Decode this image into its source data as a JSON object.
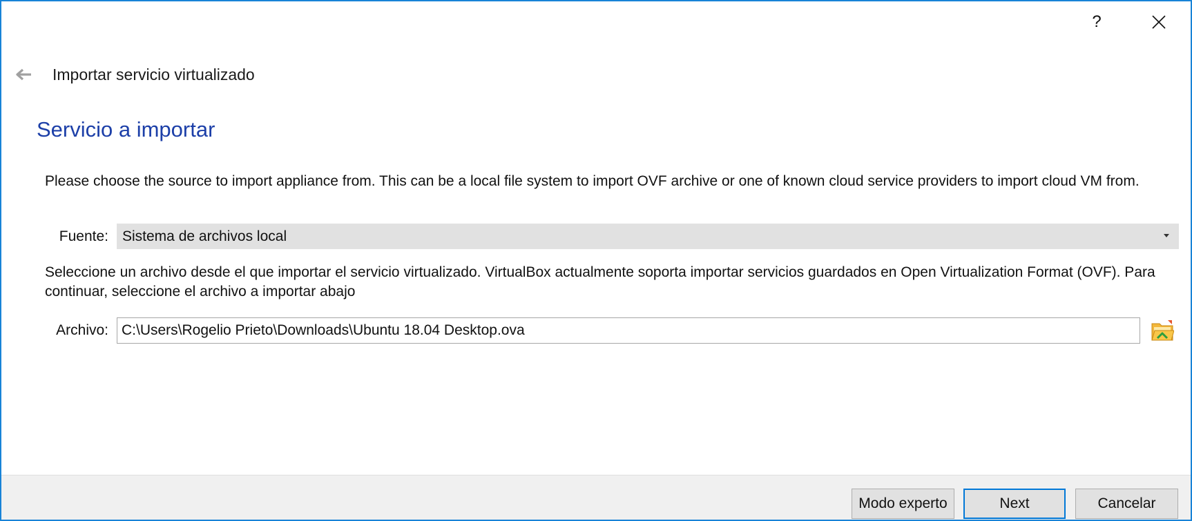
{
  "titlebar": {
    "help_label": "?",
    "close_icon": "close-icon"
  },
  "header": {
    "back_icon": "back-arrow-icon",
    "title": "Importar servicio virtualizado"
  },
  "page": {
    "heading": "Servicio a importar",
    "description": "Please choose the source to import appliance from. This can be a local file system to import OVF archive or one of known cloud service providers to import cloud VM from.",
    "source_label": "Fuente:",
    "source_value": "Sistema de archivos local",
    "file_description": "Seleccione un archivo desde el que importar el servicio virtualizado. VirtualBox actualmente soporta importar servicios guardados en Open Virtualization Format (OVF). Para continuar, seleccione el archivo a importar abajo",
    "file_label": "Archivo:",
    "file_value": "C:\\Users\\Rogelio Prieto\\Downloads\\Ubuntu 18.04 Desktop.ova",
    "folder_icon": "folder-open-icon"
  },
  "footer": {
    "expert_label": "Modo experto",
    "next_label": "Next",
    "cancel_label": "Cancelar"
  },
  "colors": {
    "accent": "#1883d7",
    "heading": "#1c3fa8",
    "combo_bg": "#e1e1e1",
    "footer_bg": "#f0f0f0"
  }
}
